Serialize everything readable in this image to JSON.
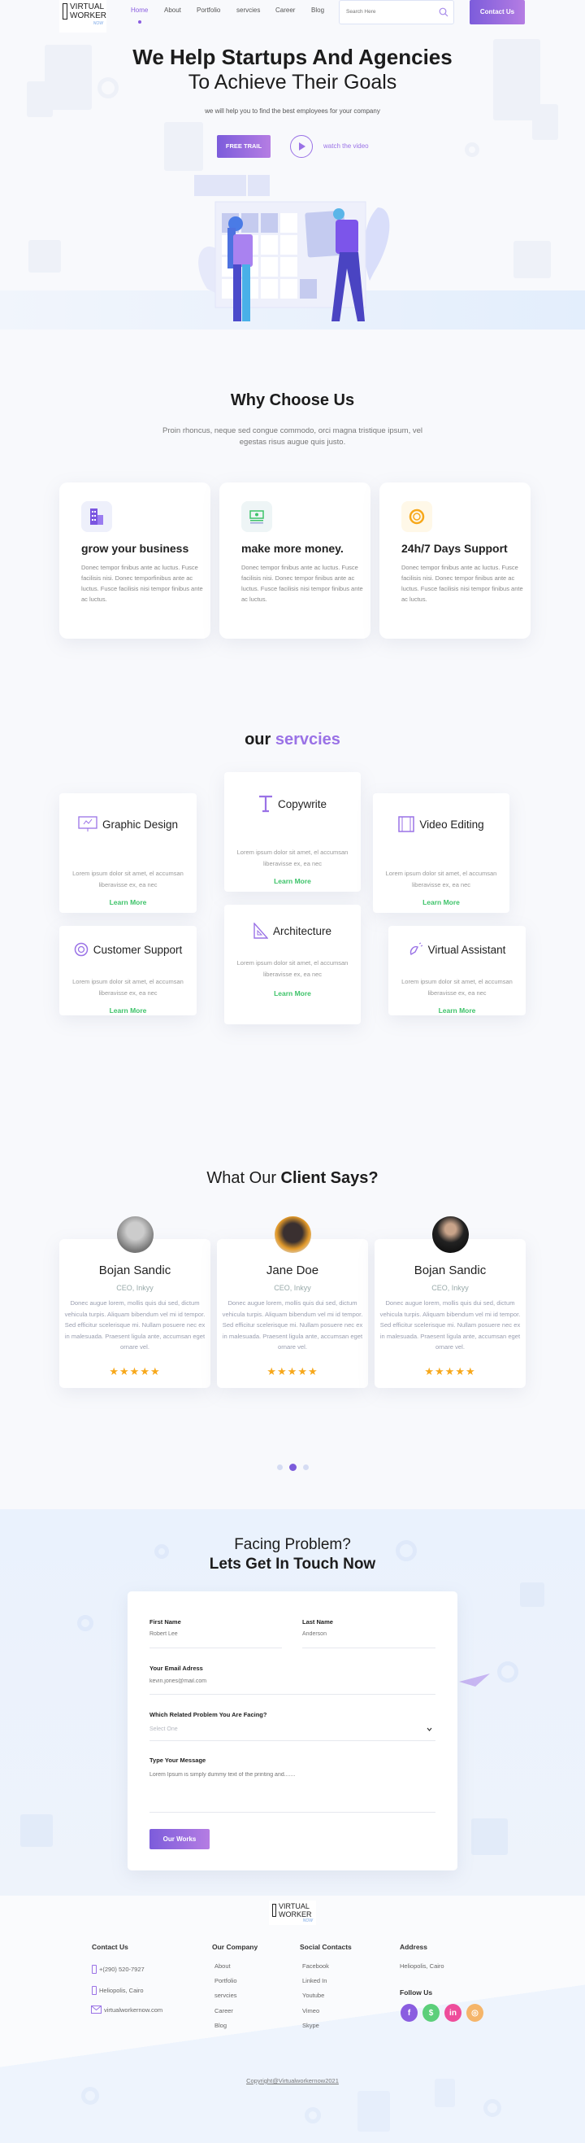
{
  "colors": {
    "accent": "#8a5de0",
    "green": "#3ec36a",
    "star": "#f7a81b",
    "bg": "#f8f9fc",
    "light_blue": "#e8f1fd"
  },
  "nav": {
    "logo": {
      "line1": "VIRTUAL",
      "line2": "WORKER",
      "line3": "NOW"
    },
    "items": [
      {
        "label": "Home",
        "active": true
      },
      {
        "label": "About"
      },
      {
        "label": "Portfolio"
      },
      {
        "label": "servcies"
      },
      {
        "label": "Career"
      },
      {
        "label": "Blog"
      }
    ],
    "search_placeholder": "Search Here",
    "contact_label": "Contact Us"
  },
  "hero": {
    "title_line1": "We Help Startups And Agencies",
    "title_line2": "To Achieve Their Goals",
    "subtitle": "we will help you to find the best employees for your company",
    "cta_label": "FREE TRAIL",
    "video_label": "watch the video"
  },
  "why": {
    "title": "Why Choose Us",
    "description": "Proin rhoncus, neque sed congue commodo, orci magna tristique ipsum, vel egestas risus augue quis justo.",
    "cards": [
      {
        "icon": "building-icon",
        "title": "grow your business",
        "text": "Donec tempor finibus ante ac luctus. Fusce facilisis nisi. Donec temporfinibus ante ac luctus. Fusce facilisis nisi tempor finibus ante ac luctus."
      },
      {
        "icon": "money-icon",
        "title": "make more money.",
        "text": "Donec tempor finibus ante ac luctus. Fusce facilisis nisi. Donec tempor finibus ante ac luctus.  Fusce facilisis nisi tempor finibus ante ac luctus."
      },
      {
        "icon": "lifebuoy-icon",
        "title": "24h/7 Days Support",
        "text": "Donec tempor finibus ante ac luctus. Fusce facilisis nisi. Donec tempor finibus ante ac luctus.  Fusce facilisis nisi tempor finibus ante ac luctus."
      }
    ]
  },
  "services": {
    "title_plain": "our",
    "title_accent": "servcies",
    "items": [
      {
        "icon": "monitor-chart-icon",
        "title": "Graphic Design",
        "text": "Lorem ipsum dolor sit amet, el accumsan liberavisse ex, ea nec",
        "link": "Learn More"
      },
      {
        "icon": "text-t-icon",
        "title": "Copywrite",
        "text": "Lorem ipsum dolor sit amet, el accumsan liberavisse ex, ea nec",
        "link": "Learn More"
      },
      {
        "icon": "film-icon",
        "title": "Video Editing",
        "text": "Lorem ipsum dolor sit amet, el accumsan liberavisse ex, ea nec",
        "link": "Learn More"
      },
      {
        "icon": "lifebuoy-icon",
        "title": "Customer Support",
        "text": "Lorem ipsum dolor sit amet, el accumsan liberavisse ex, ea nec",
        "link": "Learn More"
      },
      {
        "icon": "ruler-icon",
        "title": "Architecture",
        "text": "Lorem ipsum dolor sit amet, el accumsan liberavisse ex, ea nec",
        "link": "Learn More"
      },
      {
        "icon": "hand-click-icon",
        "title": "Virtual Assistant",
        "text": "Lorem ipsum dolor sit amet, el accumsan liberavisse ex, ea nec",
        "link": "Learn More"
      }
    ]
  },
  "clients": {
    "title_plain": "What Our",
    "title_bold": "Client Says?",
    "items": [
      {
        "name": "Bojan Sandic",
        "role": "CEO, Inkyy",
        "text": "Donec augue lorem, mollis quis dui sed, dictum vehicula turpis. Aliquam bibendum vel mi id tempor. Sed efficitur scelerisque mi. Nullam posuere nec ex in malesuada. Praesent ligula ante, accumsan eget ornare vel.",
        "rating": 5
      },
      {
        "name": "Jane Doe",
        "role": "CEO, Inkyy",
        "text": "Donec augue lorem, mollis quis dui sed, dictum vehicula turpis. Aliquam bibendum vel mi id tempor. Sed efficitur scelerisque mi. Nullam posuere nec ex in malesuada. Praesent ligula ante, accumsan eget ornare vel.",
        "rating": 5
      },
      {
        "name": "Bojan Sandic",
        "role": "CEO, Inkyy",
        "text": "Donec augue lorem, mollis quis dui sed, dictum vehicula turpis. Aliquam bibendum vel mi id tempor. Sed efficitur scelerisque mi. Nullam posuere nec ex in malesuada. Praesent ligula ante, accumsan eget ornare vel.",
        "rating": 5
      }
    ],
    "stars": "★★★★★",
    "carousel_active": 2,
    "carousel_count": 3
  },
  "contact": {
    "title_line1": "Facing Problem?",
    "title_line2": "Lets Get In Touch Now",
    "first_name_label": "First Name",
    "first_name_placeholder": "Robert Lee",
    "last_name_label": "Last Name",
    "last_name_placeholder": "Anderson",
    "email_label": "Your Email Adress",
    "email_placeholder": "kevin.jones@mail.com",
    "problem_label": "Which Related Problem You Are Facing?",
    "problem_value": "Select One",
    "message_label": "Type Your Message",
    "message_placeholder": "Lorem Ipsum is simply dummy text of the printing and.......",
    "submit_label": "Our Works"
  },
  "footer": {
    "contact_heading": "Contact Us",
    "phone": "+(290) 520-7927",
    "location": "Heliopolis, Cairo",
    "email": "virtualworkernow.com",
    "company_heading": "Our Company",
    "company_links": [
      "About",
      "Portfolio",
      "servcies",
      "Career",
      "Blog"
    ],
    "social_heading": "Social Contacts",
    "social_links": [
      "Facebook",
      "Linked In",
      "Youtube",
      "Vimeo",
      "Skype"
    ],
    "address_heading": "Address",
    "address": "Heliopolis, Cairo",
    "follow_heading": "Follow Us",
    "follow_icons": [
      {
        "name": "facebook-icon",
        "glyph": "f",
        "color": "#8a5de0"
      },
      {
        "name": "dollar-icon",
        "glyph": "$",
        "color": "#5ccf7a"
      },
      {
        "name": "linkedin-icon",
        "glyph": "in",
        "color": "#ee4d9b"
      },
      {
        "name": "dribbble-icon",
        "glyph": "◎",
        "color": "#f5b56a"
      }
    ],
    "copyright": "Copyright@Virtualworkernow2021"
  }
}
